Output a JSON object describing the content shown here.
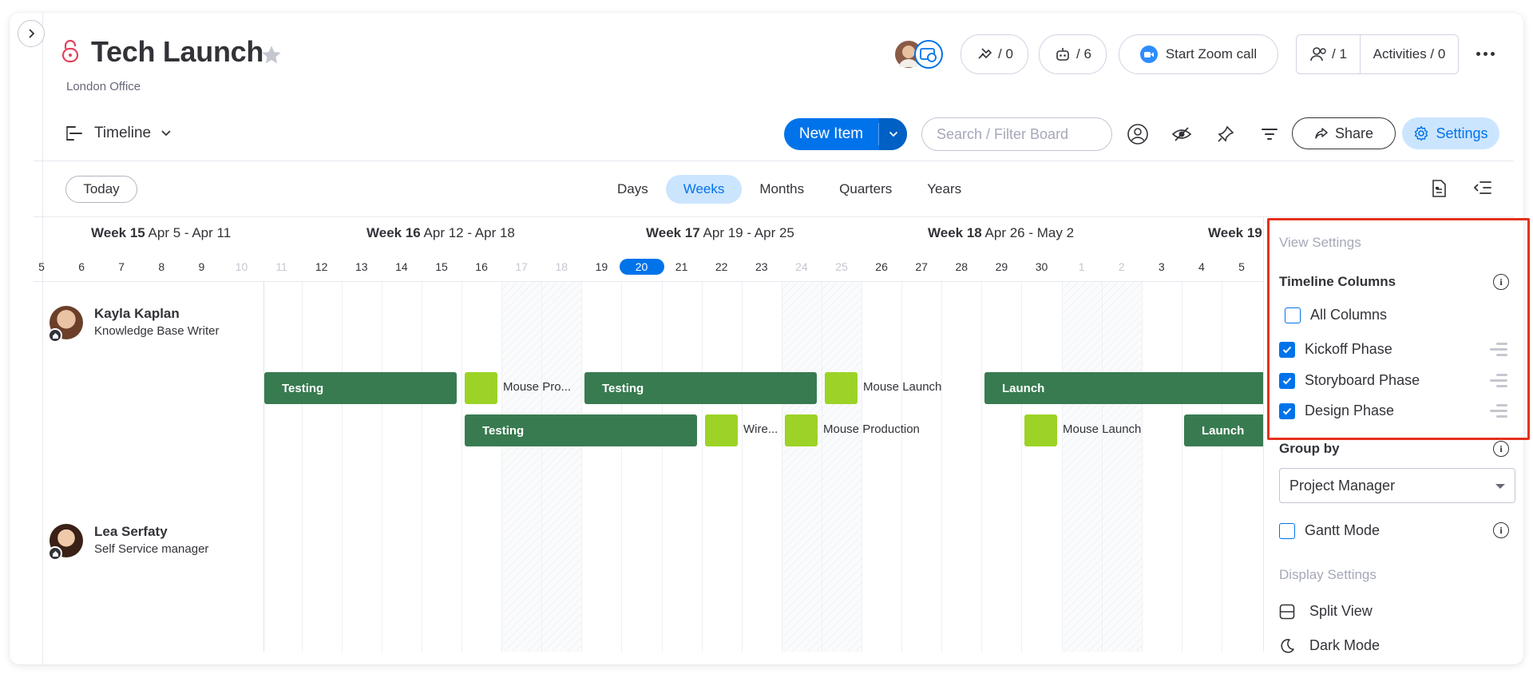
{
  "header": {
    "title": "Tech Launch",
    "subtitle": "London Office",
    "updates_count": "/ 0",
    "automations_count": "/ 6",
    "zoom_label": "Start Zoom call",
    "members_count": "/ 1",
    "activities_label": "Activities / 0"
  },
  "toolbar": {
    "view_label": "Timeline",
    "new_item_label": "New Item",
    "search_placeholder": "Search / Filter Board",
    "share_label": "Share",
    "settings_label": "Settings"
  },
  "scale": {
    "today_label": "Today",
    "tabs": [
      {
        "label": "Days",
        "active": false
      },
      {
        "label": "Weeks",
        "active": true
      },
      {
        "label": "Months",
        "active": false
      },
      {
        "label": "Quarters",
        "active": false
      },
      {
        "label": "Years",
        "active": false
      }
    ]
  },
  "timeline": {
    "weeks": [
      {
        "name": "Week 15",
        "range": "Apr 5 - Apr 11"
      },
      {
        "name": "Week 16",
        "range": "Apr 12 - Apr 18"
      },
      {
        "name": "Week 17",
        "range": "Apr 19 - Apr 25"
      },
      {
        "name": "Week 18",
        "range": "Apr 26 - May 2"
      },
      {
        "name": "Week 19",
        "range": ""
      }
    ],
    "days": [
      "5",
      "6",
      "7",
      "8",
      "9",
      "10",
      "11",
      "12",
      "13",
      "14",
      "15",
      "16",
      "17",
      "18",
      "19",
      "20",
      "21",
      "22",
      "23",
      "24",
      "25",
      "26",
      "27",
      "28",
      "29",
      "30",
      "1",
      "2",
      "3",
      "4",
      "5"
    ],
    "weekend_days_index": [
      5,
      6,
      12,
      13,
      19,
      20,
      26,
      27
    ],
    "today_index": 15,
    "people": [
      {
        "name": "Kayla Kaplan",
        "role": "Knowledge Base Writer"
      },
      {
        "name": "Lea Serfaty",
        "role": "Self Service manager"
      }
    ],
    "items": {
      "row1": {
        "testing1": "Testing",
        "mouse_pro": "Mouse Pro...",
        "testing2": "Testing",
        "mouse_launch": "Mouse Launch",
        "launch": "Launch"
      },
      "row2": {
        "testing": "Testing",
        "wire": "Wire...",
        "mouse_production": "Mouse Production",
        "mouse_launch": "Mouse Launch",
        "launch": "Launch"
      }
    }
  },
  "settings_panel": {
    "view_settings_title": "View Settings",
    "timeline_columns_title": "Timeline Columns",
    "all_columns_label": "All Columns",
    "columns": [
      {
        "label": "Kickoff Phase",
        "checked": true
      },
      {
        "label": "Storyboard Phase",
        "checked": true
      },
      {
        "label": "Design Phase",
        "checked": true
      }
    ],
    "group_by_title": "Group by",
    "group_by_value": "Project Manager",
    "gantt_mode_label": "Gantt Mode",
    "display_settings_title": "Display Settings",
    "split_view_label": "Split View",
    "dark_mode_label": "Dark Mode",
    "info_glyph": "i"
  },
  "colors": {
    "accent": "#0073ea",
    "accent_light": "#cce5ff",
    "bar_green": "#387b50",
    "milestone_green": "#9cd326",
    "highlight_red": "#e4311d",
    "lock_red": "#e2445c"
  }
}
